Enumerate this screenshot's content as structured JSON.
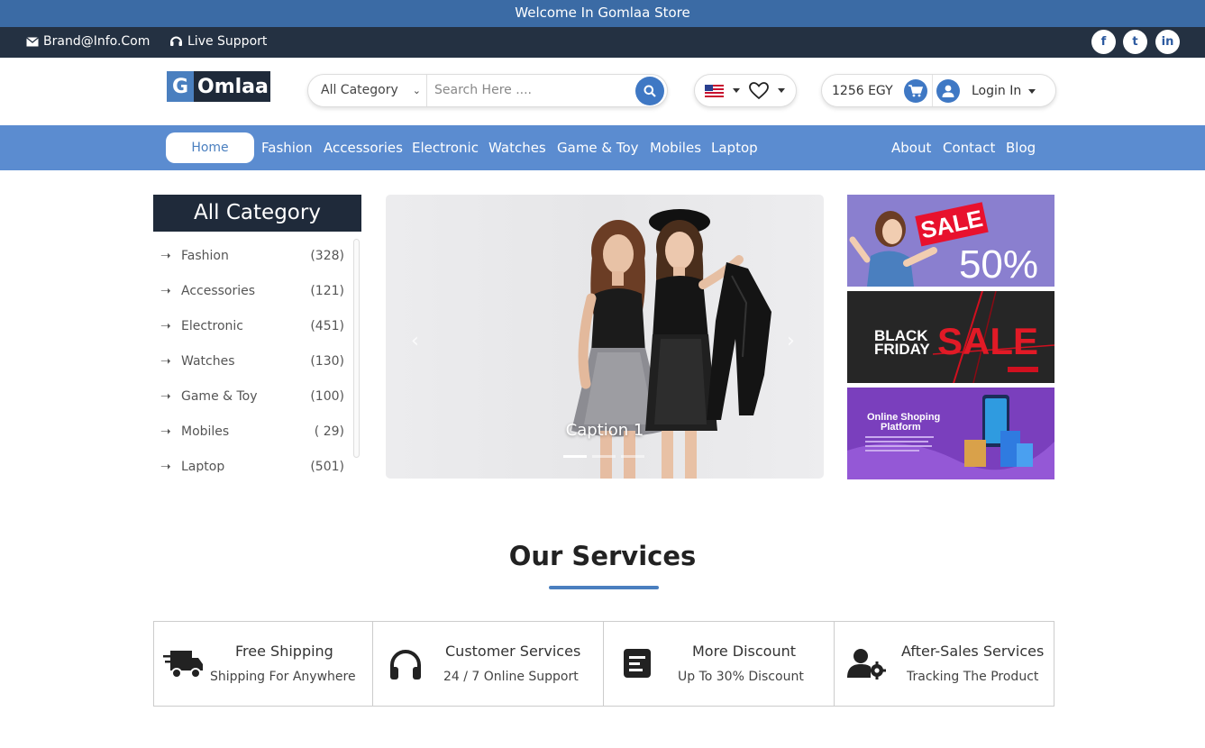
{
  "topbar": {
    "welcome": "Welcome In Gomlaa Store"
  },
  "infobar": {
    "email": "Brand@Info.Com",
    "support": "Live Support",
    "social": [
      "f",
      "t",
      "in"
    ]
  },
  "logo": {
    "letter": "G",
    "rest": "Omlaa"
  },
  "search": {
    "category": "All Category",
    "placeholder": "Search Here ...."
  },
  "cart": {
    "amount": "1256 EGY"
  },
  "account": {
    "login": "Login In"
  },
  "nav": {
    "home": "Home",
    "links": [
      "Fashion",
      "Accessories",
      "Electronic",
      "Watches",
      "Game & Toy",
      "Mobiles",
      "Laptop"
    ],
    "right_links": [
      "About",
      "Contact",
      "Blog"
    ]
  },
  "sidebar": {
    "title": "All Category",
    "items": [
      {
        "label": "Fashion",
        "count": "(328)"
      },
      {
        "label": "Accessories",
        "count": "(121)"
      },
      {
        "label": "Electronic",
        "count": "(451)"
      },
      {
        "label": "Watches",
        "count": "(130)"
      },
      {
        "label": "Game & Toy",
        "count": "(100)"
      },
      {
        "label": "Mobiles",
        "count": "( 29)"
      },
      {
        "label": "Laptop",
        "count": "(501)"
      }
    ]
  },
  "slider": {
    "caption": "Caption 1"
  },
  "banners": {
    "sale": {
      "tag": "SALE",
      "percent": "50%"
    },
    "black_friday": {
      "line1": "BLACK",
      "line2": "FRIDAY",
      "sale": "SALE"
    },
    "online": {
      "line1": "Online Shoping",
      "line2": "Platform"
    }
  },
  "services": {
    "title": "Our Services",
    "items": [
      {
        "title": "Free Shipping",
        "subtitle": "Shipping For Anywhere"
      },
      {
        "title": "Customer Services",
        "subtitle": "24 / 7 Online Support"
      },
      {
        "title": "More Discount",
        "subtitle": "Up To 30% Discount"
      },
      {
        "title": "After-Sales Services",
        "subtitle": "Tracking The Product"
      }
    ]
  },
  "colors": {
    "topbar": "#3b6ba5",
    "infobar": "#243142",
    "nav": "#5b8cd0",
    "accent": "#3f78c4",
    "dark": "#1f2a3a"
  }
}
